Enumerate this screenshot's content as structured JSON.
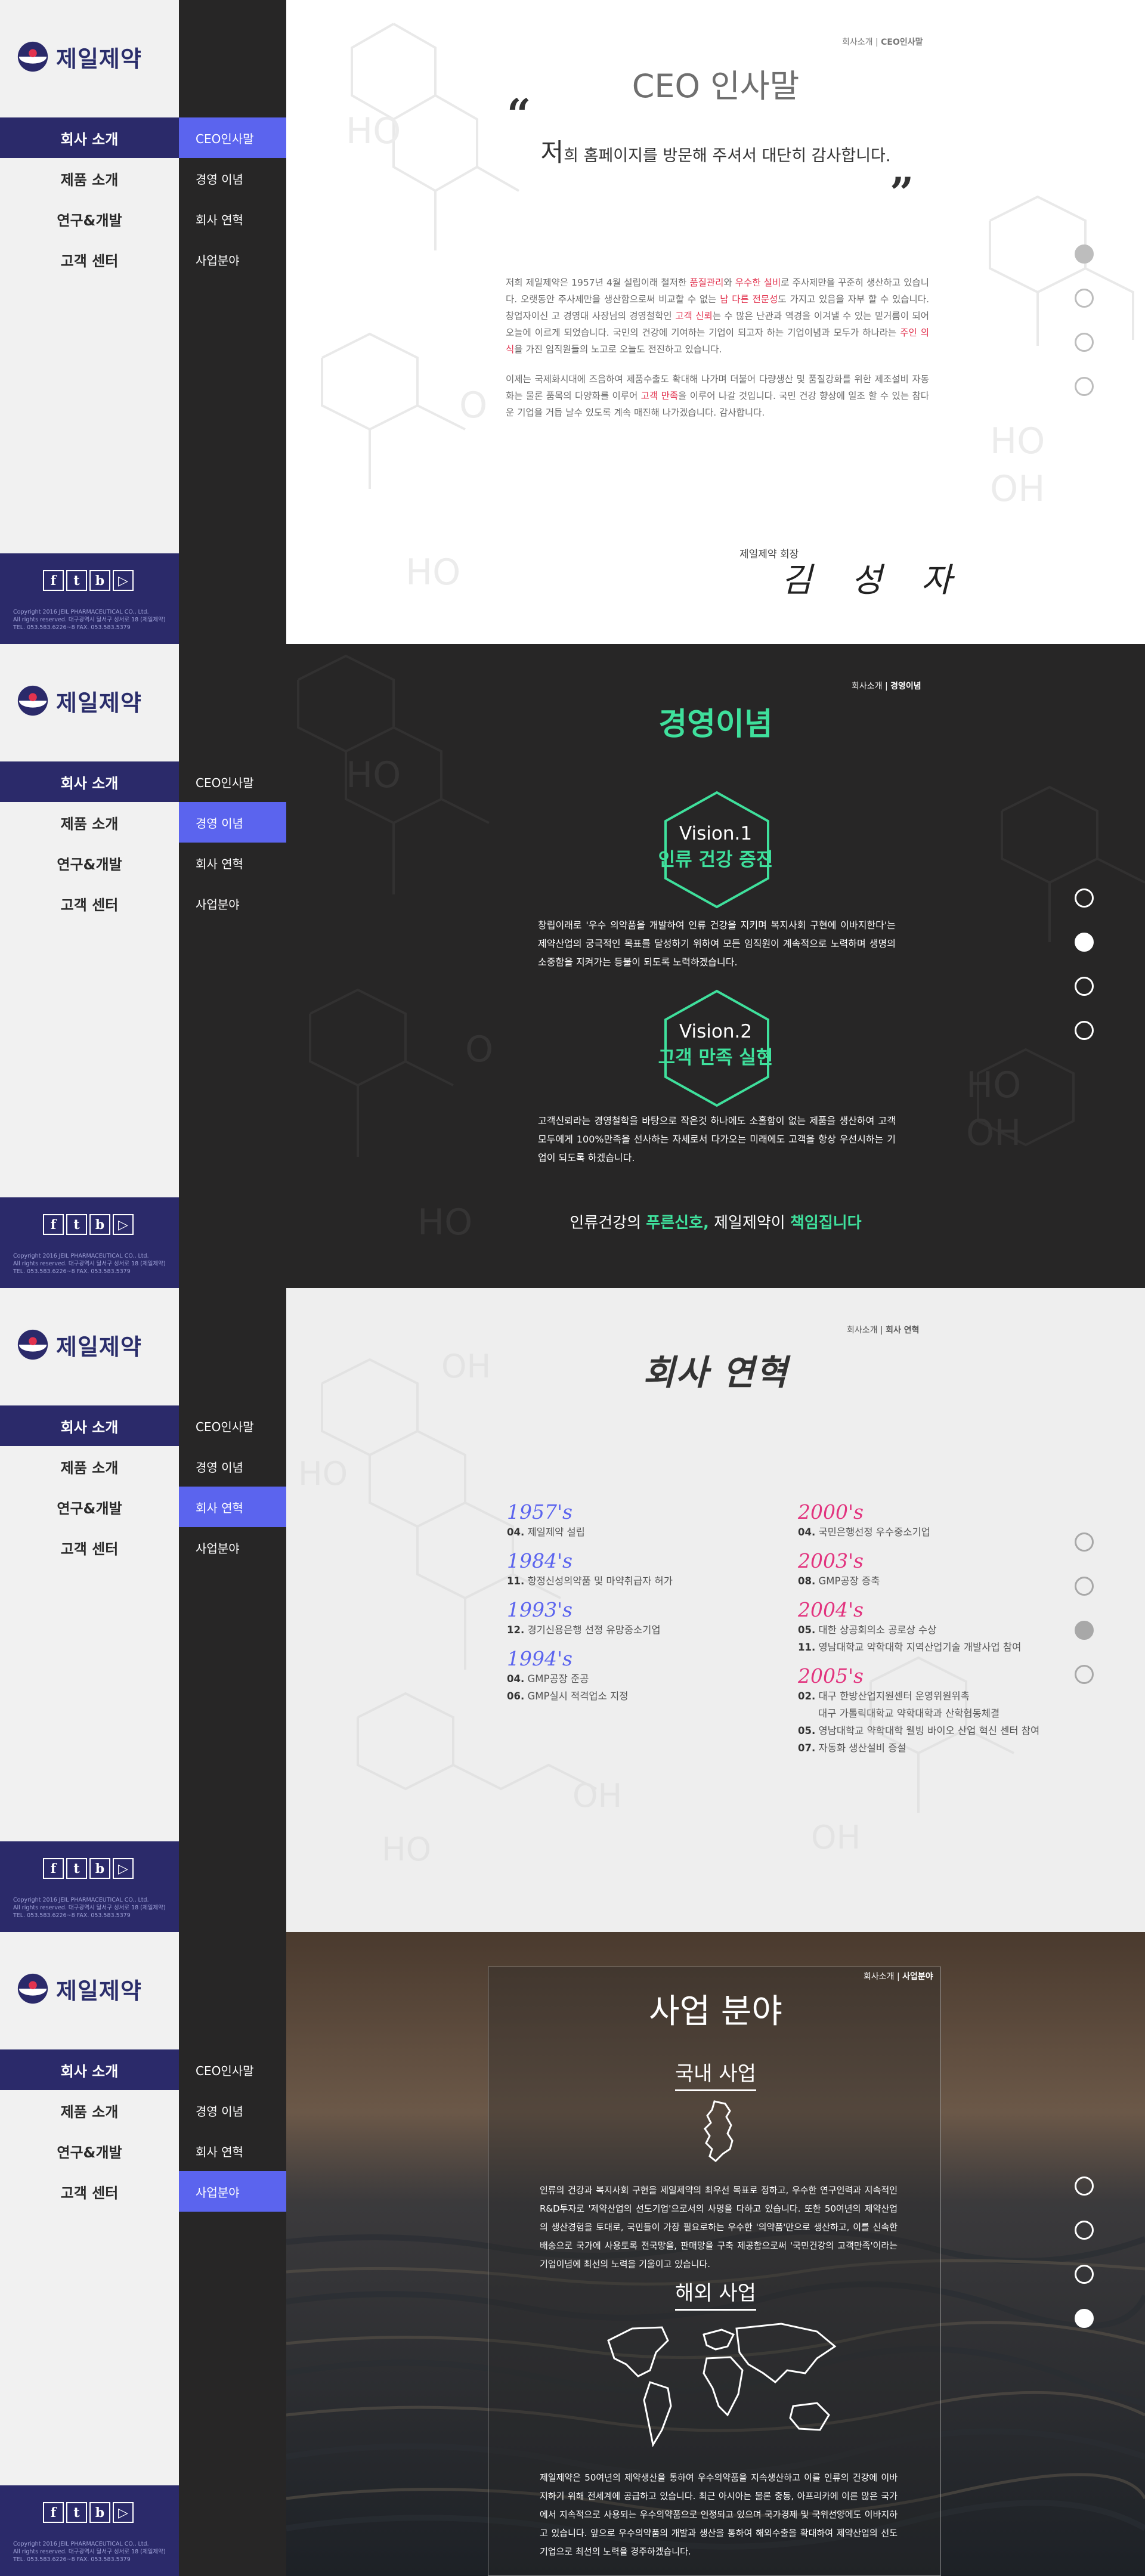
{
  "brand": {
    "name": "제일제약",
    "colors": {
      "navy": "#2b2a6a",
      "accent_blue": "#5b64ee",
      "green": "#3fe09c",
      "red": "#e2334f",
      "pink": "#e2337e",
      "dark": "#272626"
    }
  },
  "nav": {
    "main": [
      "회사 소개",
      "제품 소개",
      "연구&개발",
      "고객 센터"
    ],
    "sub": [
      "CEO인사말",
      "경영 이념",
      "회사 연혁",
      "사업분야"
    ]
  },
  "footer": {
    "sns": [
      "f",
      "t",
      "b",
      "▷"
    ],
    "sns_icons": [
      "facebook-icon",
      "twitter-icon",
      "blog-icon",
      "youtube-icon"
    ],
    "copy_1": "Copyright 2016 JEIL PHARMACEUTICAL CO., Ltd.",
    "copy_2": "All rights reserved. 대구광역시 달서구 성서로 18 (제일제약)",
    "copy_3": "TEL. 053.583.6226~8 FAX. 053.583.5379"
  },
  "ceo": {
    "crumb_section": "회사소개",
    "crumb_page": "CEO인사말",
    "title": "CEO 인사말",
    "quote_open": "“",
    "quote_close": "”",
    "greet_first": "저",
    "greet_rest": "희 홈페이지를 방문해 주셔서 대단히 감사합니다.",
    "p1_a": "저희 제일제약은 1957년 4월 설립이래 철저한 ",
    "p1_hl1": "품질관리",
    "p1_b": "와 ",
    "p1_hl2": "우수한 설비",
    "p1_c": "로 주사제만을 꾸준히 생산하고 있습니다. 오랫동안 주사제만을 생산함으로써 비교할 수 없는 ",
    "p1_hl3": "남 다른 전문성",
    "p1_d": "도 가지고 있음을 자부 할 수 있습니다. 창업자이신 고 경영대 사장님의 경영철학인 ",
    "p1_hl4": "고객 신뢰",
    "p1_e": "는 수 많은 난관과 역경을 이겨낼 수 있는 밑거름이 되어 오늘에 이르게 되었습니다. 국민의 건강에 기여하는 기업이 되고자 하는 기업이념과 모두가 하나라는 ",
    "p1_hl5": "주인 의식",
    "p1_f": "을 가진 임직원들의 노고로 오늘도 전진하고 있습니다.",
    "p2_a": "이제는 국제화시대에 즈음하여 제품수출도 확대해 나가며 더불어 다량생산 및 품질강화를 위한 제조설비 자동화는 물론 품목의 다양화를 이루어 ",
    "p2_hl": "고객 만족",
    "p2_b": "을 이루어 나갈 것입니다. 국민 건강 향상에 일조 할 수 있는 참다운 기업을 거듭 날수 있도록 계속 매진해 나가겠습니다. 감사합니다.",
    "sign_label": "제일제약 회장",
    "sign_name": "김 성 자"
  },
  "vision": {
    "crumb_section": "회사소개",
    "crumb_page": "경영이념",
    "title": "경영이념",
    "v1_label": "Vision.1",
    "v1_title": "인류 건강 증진",
    "v1_body": "창립이래로 '우수 의약품을 개발하여 인류 건강을 지키며 복지사회 구현에 이바지한다'는 제약산업의 궁극적인 목표를 달성하기 위하여 모든 임직원이 계속적으로 노력하며 생명의 소중함을 지켜가는 등불이 되도록 노력하겠습니다.",
    "v2_label": "Vision.2",
    "v2_title": "고객 만족 실현",
    "v2_body": "고객신뢰라는 경영철학을 바탕으로 작은것 하나에도 소홀함이 없는 제품을 생산하여 고객 모두에게 100%만족을 선사하는 자세로서 다가오는 미래에도 고객을 항상 우선시하는 기업이 되도록 하겠습니다.",
    "foot_a": "인류건강의 ",
    "foot_g1": "푸른신호,",
    "foot_b": " 제일제약이 ",
    "foot_g2": "책임집니다"
  },
  "history": {
    "crumb_section": "회사소개",
    "crumb_page": "회사 연혁",
    "title": "회사 연혁",
    "left": [
      {
        "year": "1957's",
        "entries": [
          [
            "04.",
            "제일제약 설립"
          ]
        ]
      },
      {
        "year": "1984's",
        "entries": [
          [
            "11.",
            "향정신성의약품 및 마약취급자 허가"
          ]
        ]
      },
      {
        "year": "1993's",
        "entries": [
          [
            "12.",
            "경기신용은행 선정 유망중소기업"
          ]
        ]
      },
      {
        "year": "1994's",
        "entries": [
          [
            "04.",
            "GMP공장 준공"
          ],
          [
            "06.",
            "GMP실시 적격업소 지정"
          ]
        ]
      }
    ],
    "right": [
      {
        "year": "2000's",
        "entries": [
          [
            "04.",
            "국민은행선정 우수중소기업"
          ]
        ]
      },
      {
        "year": "2003's",
        "entries": [
          [
            "08.",
            "GMP공장 증축"
          ]
        ]
      },
      {
        "year": "2004's",
        "entries": [
          [
            "05.",
            "대한 상공회의소 공로상 수상"
          ],
          [
            "11.",
            "영남대학교 약학대학 지역산업기술 개발사업 참여"
          ]
        ]
      },
      {
        "year": "2005's",
        "entries": [
          [
            "02.",
            "대구 한방산업지원센터 운영위원위촉"
          ],
          [
            "",
            "대구 가톨릭대학교 약학대학과 산학협동체결"
          ],
          [
            "05.",
            "영남대학교 약학대학 웰빙 바이오 산업 혁신 센터 참여"
          ],
          [
            "07.",
            "자동화 생산설비 증설"
          ]
        ]
      }
    ]
  },
  "business": {
    "crumb_section": "회사소개",
    "crumb_page": "사업분야",
    "title": "사업 분야",
    "domestic_title": "국내 사업",
    "domestic_body": "인류의 건강과 복지사회 구현을 제일제약의 최우선 목표로 정하고, 우수한 연구인력과 지속적인 R&D투자로 '제약산업의 선도기업'으로서의 사명을 다하고 있습니다. 또한 50여년의 제약산업의 생산경험을 토대로, 국민들이 가장 필요로하는 우수한 '의약품'만으로 생산하고, 이를 신속한 배송으로 국가에 사용토록 전국망을, 판매망을 구축 제공함으로써 '국민건강의 고객만족'이라는 기업이념에 최선의 노력을 기울이고 있습니다.",
    "overseas_title": "해외 사업",
    "overseas_body": "제일제약은 50여년의 제약생산을 통하여 우수의약품을 지속생산하고 이를 인류의 건강에 이바지하기 위해 전세계에 공급하고 있습니다. 최근 아시아는 물론 중동, 아프리카에 이른 많은 국가에서 지속적으로 사용되는 우수의약품으로 인정되고 있으며 국가경제 및 국위선양에도 이바지하고 있습니다. 앞으로 우수의약품의 개발과 생산을 통하여 해외수출을 확대하여 제약산업의 선도기업으로 최선의 노력을 경주하겠습니다."
  }
}
